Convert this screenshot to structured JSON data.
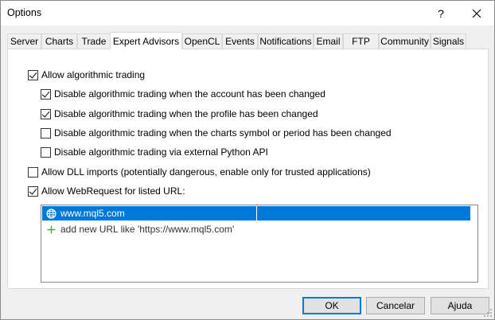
{
  "window": {
    "title": "Options",
    "help_label": "?"
  },
  "tabs": [
    {
      "label": "Server"
    },
    {
      "label": "Charts"
    },
    {
      "label": "Trade"
    },
    {
      "label": "Expert Advisors"
    },
    {
      "label": "OpenCL"
    },
    {
      "label": "Events"
    },
    {
      "label": "Notifications"
    },
    {
      "label": "Email"
    },
    {
      "label": "FTP"
    },
    {
      "label": "Community"
    },
    {
      "label": "Signals"
    }
  ],
  "active_tab": "Expert Advisors",
  "options": {
    "allow_algo": {
      "label": "Allow algorithmic trading",
      "checked": true
    },
    "disable_account": {
      "label": "Disable algorithmic trading when the account has been changed",
      "checked": true
    },
    "disable_profile": {
      "label": "Disable algorithmic trading when the profile has been changed",
      "checked": true
    },
    "disable_symbol": {
      "label": "Disable algorithmic trading when the charts symbol or period has been changed",
      "checked": false
    },
    "disable_python": {
      "label": "Disable algorithmic trading via external Python API",
      "checked": false
    },
    "allow_dll": {
      "label": "Allow DLL imports (potentially dangerous, enable only for trusted applications)",
      "checked": false
    },
    "allow_webrequest": {
      "label": "Allow WebRequest for listed URL:",
      "checked": true
    }
  },
  "url_list": {
    "items": [
      "www.mql5.com"
    ],
    "add_placeholder": "add new URL like 'https://www.mql5.com'"
  },
  "buttons": {
    "ok": "OK",
    "cancel": "Cancelar",
    "help": "Ajuda"
  },
  "colors": {
    "selection": "#0078d7",
    "add_icon": "#3cb043"
  }
}
